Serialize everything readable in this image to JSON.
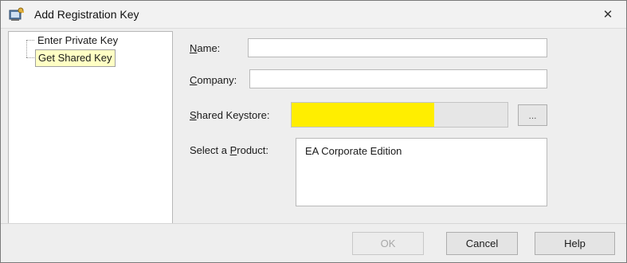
{
  "window": {
    "title": "Add Registration Key",
    "close_glyph": "✕",
    "title_icon": "registration-key-icon"
  },
  "tree": {
    "items": [
      {
        "label": "Enter Private Key",
        "selected": false
      },
      {
        "label": "Get Shared Key",
        "selected": true
      }
    ]
  },
  "form": {
    "name": {
      "label_mnemonic": "N",
      "label_rest": "ame:",
      "value": ""
    },
    "company": {
      "label_mnemonic": "C",
      "label_rest": "ompany:",
      "value": ""
    },
    "shared_keystore": {
      "label_mnemonic": "S",
      "label_rest": "hared Keystore:",
      "value": "",
      "highlight_color": "#ffee00",
      "redaction_fraction": 0.66
    },
    "browse_label": "...",
    "product": {
      "label_prefix": "Select a ",
      "label_mnemonic": "P",
      "label_rest": "roduct:",
      "options": [
        "EA Corporate Edition"
      ]
    }
  },
  "buttons": {
    "ok": "OK",
    "ok_disabled": true,
    "cancel": "Cancel",
    "help": "Help"
  },
  "colors": {
    "selection": "#ffffc4",
    "highlight": "#ffee00"
  }
}
